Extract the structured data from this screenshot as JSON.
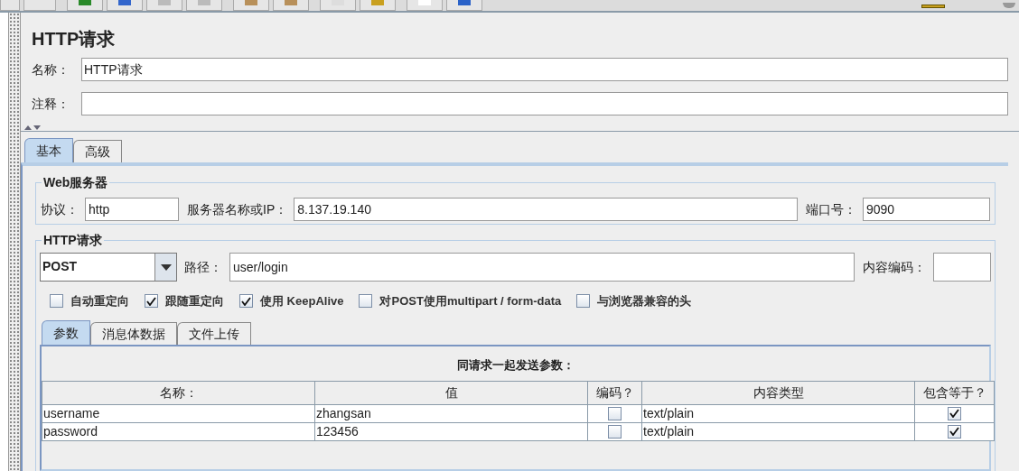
{
  "title": "HTTP请求",
  "fields": [
    {
      "label": "名称：",
      "value": "HTTP请求"
    },
    {
      "label": "注释："
    }
  ],
  "tabs": [
    {
      "label": "基本",
      "selected": true
    },
    {
      "label": "高级",
      "selected": false
    }
  ],
  "web_server": {
    "legend": "Web服务器",
    "protocol_label": "协议：",
    "protocol": "http",
    "server_label": "服务器名称或IP：",
    "server": "8.137.19.140",
    "port_label": "端口号：",
    "port": "9090"
  },
  "http_request": {
    "legend": "HTTP请求",
    "method": "POST",
    "path_label": "路径：",
    "path": "user/login",
    "encoding_label": "内容编码：",
    "options": [
      {
        "label": "自动重定向",
        "checked": false
      },
      {
        "label": "跟随重定向",
        "checked": true
      },
      {
        "label": "使用 KeepAlive",
        "checked": true
      },
      {
        "label": "对POST使用multipart / form-data",
        "checked": false
      },
      {
        "label": "与浏览器兼容的头",
        "checked": false
      }
    ]
  },
  "sub_tabs": [
    {
      "label": "参数",
      "selected": true
    },
    {
      "label": "消息体数据",
      "selected": false
    },
    {
      "label": "文件上传",
      "selected": false
    }
  ],
  "parameters": {
    "caption": "同请求一起发送参数：",
    "columns": [
      "名称：",
      "值",
      "编码？",
      "内容类型",
      "包含等于？"
    ],
    "rows": [
      {
        "name": "username",
        "value": "zhangsan",
        "encode": false,
        "content_type": "text/plain",
        "include_equals": true
      },
      {
        "name": "password",
        "value": "123456",
        "encode": false,
        "content_type": "text/plain",
        "include_equals": true
      }
    ]
  }
}
